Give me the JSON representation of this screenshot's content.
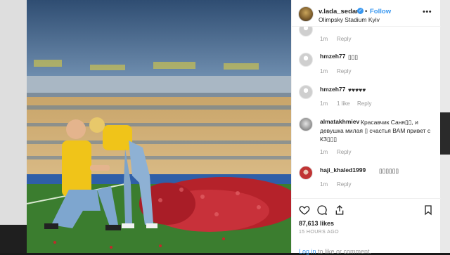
{
  "header": {
    "username": "v.lada_sedan",
    "separator": "•",
    "follow_label": "Follow",
    "location": "Olimpsky Stadium Kyiv",
    "more_label": "•••"
  },
  "comments": [
    {
      "user": "",
      "text": "",
      "time": "1m",
      "reply": "Reply"
    },
    {
      "user": "hmzeh77",
      "text": "▯▯▯",
      "time": "1m",
      "reply": "Reply"
    },
    {
      "user": "hmzeh77",
      "text": "♥♥♥♥♥",
      "time": "1m",
      "likes": "1 like",
      "reply": "Reply"
    },
    {
      "user": "almatakhmiev",
      "text": "Красавчик Саня▯▯, и девушка милая ▯ счастья ВАМ привет с КЗ▯▯▯",
      "time": "1m",
      "reply": "Reply"
    },
    {
      "user": "haji_khaled1999",
      "text": "▯▯▯▯▯▯",
      "time": "1m",
      "reply": "Reply"
    }
  ],
  "footer": {
    "likes": "87,613 likes",
    "time_ago": "15 HOURS AGO",
    "login_link": "Log in",
    "login_rest": " to like or comment."
  },
  "icons": [
    "heart-icon",
    "comment-icon",
    "share-icon",
    "bookmark-icon"
  ],
  "colors": {
    "accent": "#3897f0",
    "text": "#262626",
    "muted": "#999999"
  }
}
